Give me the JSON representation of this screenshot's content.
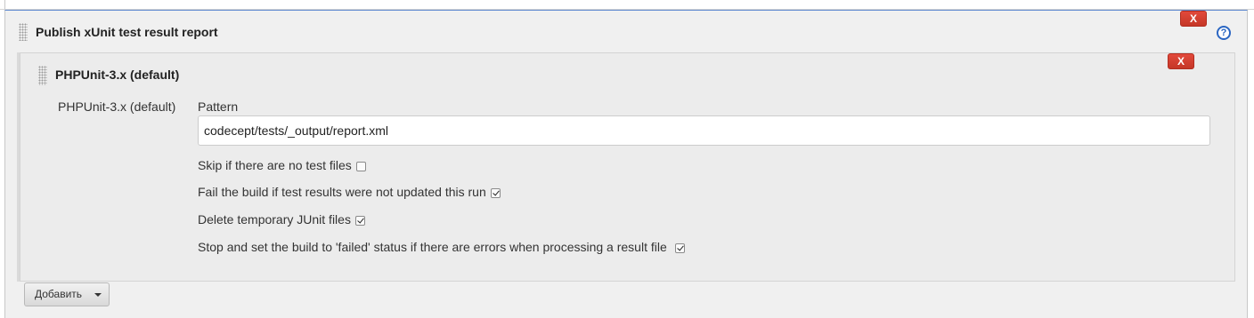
{
  "publisher": {
    "title": "Publish xUnit test result report",
    "delete_label": "X",
    "help_label": "?"
  },
  "tool": {
    "title": "PHPUnit-3.x (default)",
    "delete_label": "X",
    "field_label": "PHPUnit-3.x (default)",
    "pattern_label": "Pattern",
    "pattern_value": "codecept/tests/_output/report.xml",
    "options": [
      {
        "label": "Skip if there are no test files",
        "checked": false
      },
      {
        "label": "Fail the build if test results were not updated this run",
        "checked": true
      },
      {
        "label": "Delete temporary JUnit files",
        "checked": true
      },
      {
        "label": "Stop and set the build to 'failed' status if there are errors when processing a result file",
        "checked": true
      }
    ]
  },
  "add_button": {
    "label": "Добавить",
    "icon": "caret-down-icon"
  },
  "colors": {
    "delete": "#d63b2d",
    "help": "#2b66c2",
    "section_border": "#5f8ad0",
    "panel_bg": "#f0f0f0"
  }
}
